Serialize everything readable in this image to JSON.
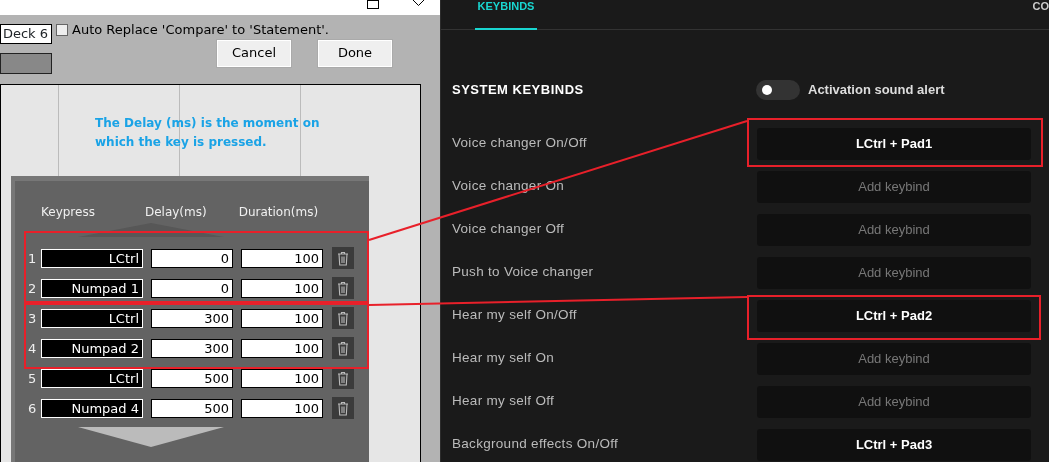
{
  "macro_dialog": {
    "deck_field": {
      "value": "Deck 6"
    },
    "auto_replace": {
      "label": "Auto Replace 'Compare' to 'Statement'.",
      "checked": false
    },
    "buttons": [
      "Cancel",
      "Done"
    ],
    "hint": "The Delay (ms) is the moment on which the key is pressed.",
    "columns": [
      "Keypress",
      "Delay(ms)",
      "Duration(ms)"
    ],
    "rows": [
      {
        "index": "1",
        "keypress": "LCtrl",
        "delay": "0",
        "duration": "100"
      },
      {
        "index": "2",
        "keypress": "Numpad 1",
        "delay": "0",
        "duration": "100"
      },
      {
        "index": "3",
        "keypress": "LCtrl",
        "delay": "300",
        "duration": "100"
      },
      {
        "index": "4",
        "keypress": "Numpad 2",
        "delay": "300",
        "duration": "100"
      },
      {
        "index": "5",
        "keypress": "LCtrl",
        "delay": "500",
        "duration": "100"
      },
      {
        "index": "6",
        "keypress": "Numpad 4",
        "delay": "500",
        "duration": "100"
      }
    ]
  },
  "settings": {
    "tabs": [
      {
        "label": "KEYBINDS",
        "selected": true
      },
      {
        "label": "CO",
        "selected": false
      }
    ],
    "section_title": "SYSTEM KEYBINDS",
    "sound_alert": {
      "label": "Activation sound alert",
      "on": false
    },
    "keybinds": [
      {
        "action": "Voice changer On/Off",
        "binding": "LCtrl + Pad1",
        "kind": "assigned"
      },
      {
        "action": "Voice changer On",
        "binding": "Add keybind",
        "kind": "empty"
      },
      {
        "action": "Voice changer Off",
        "binding": "Add keybind",
        "kind": "empty"
      },
      {
        "action": "Push to Voice changer",
        "binding": "Add keybind",
        "kind": "empty"
      },
      {
        "action": "Hear my self On/Off",
        "binding": "LCtrl + Pad2",
        "kind": "assigned"
      },
      {
        "action": "Hear my self On",
        "binding": "Add keybind",
        "kind": "empty"
      },
      {
        "action": "Hear my self Off",
        "binding": "Add keybind",
        "kind": "empty"
      },
      {
        "action": "Background effects On/Off",
        "binding": "LCtrl + Pad3",
        "kind": "assigned"
      }
    ]
  }
}
